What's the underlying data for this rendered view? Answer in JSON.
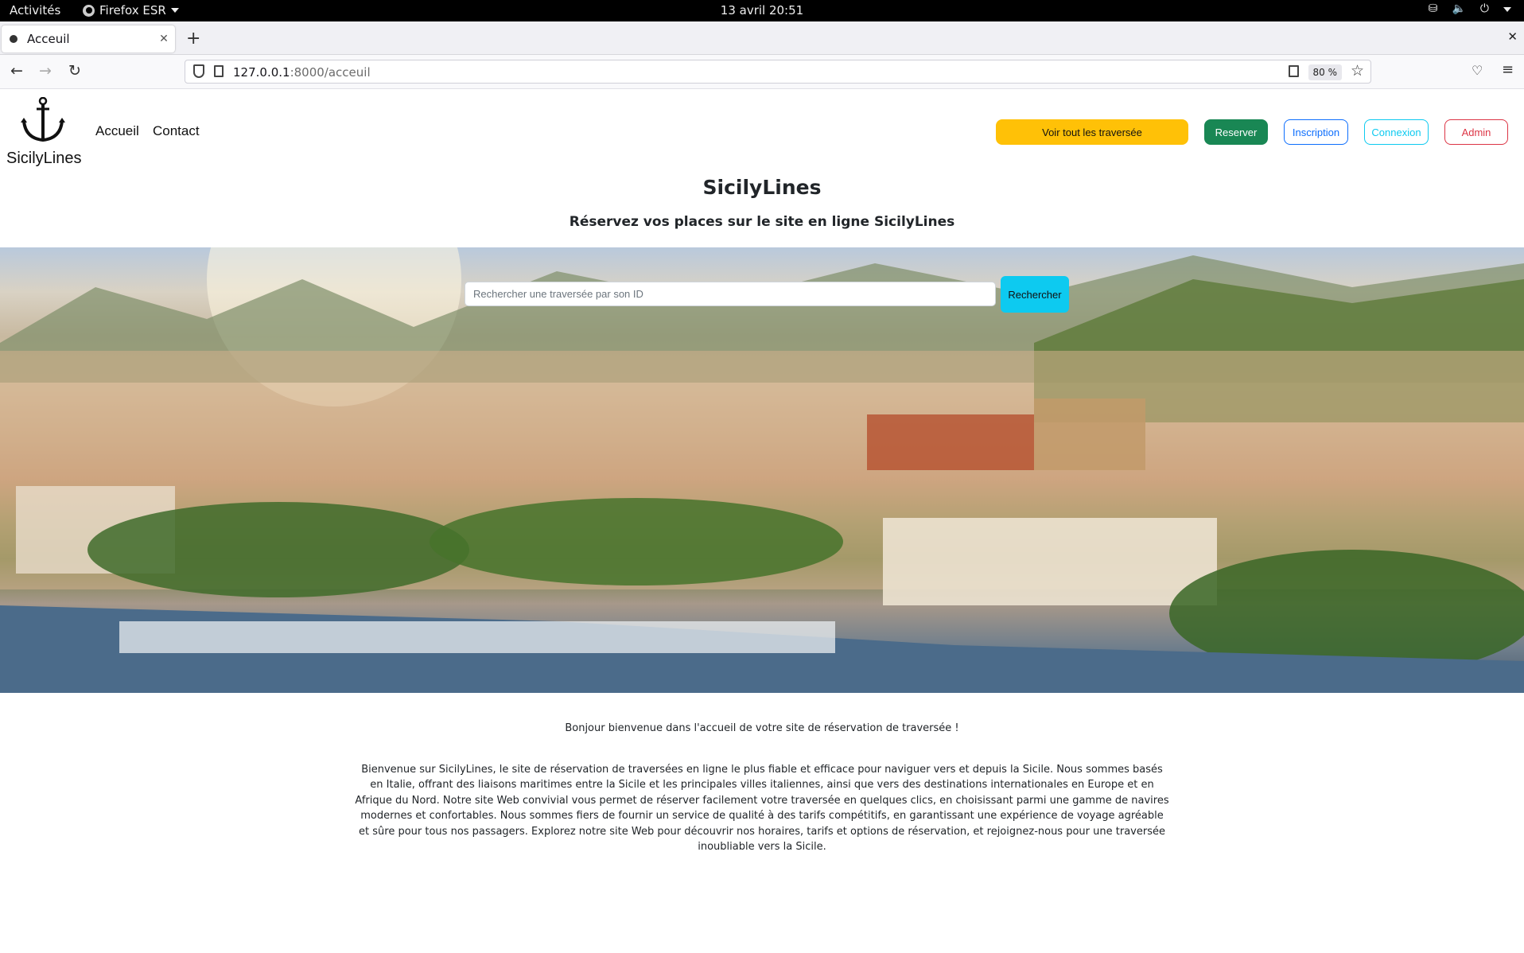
{
  "system_bar": {
    "activities": "Activités",
    "app_name": "Firefox ESR",
    "clock": "13 avril  20:51"
  },
  "browser": {
    "tab_title": "Acceuil",
    "url_host": "127.0.0.1",
    "url_path": ":8000/acceuil",
    "zoom": "80 %"
  },
  "site": {
    "logo_text": "SicilyLines",
    "nav": [
      "Accueil",
      "Contact"
    ],
    "buttons": {
      "all_crossings": "Voir tout les traversée",
      "reserve": "Reserver",
      "signup": "Inscription",
      "login": "Connexion",
      "admin": "Admin"
    },
    "title": "SicilyLines",
    "subtitle": "Réservez vos places sur le site en ligne SicilyLines",
    "search": {
      "placeholder": "Rechercher une traversée par son ID",
      "button": "Rechercher"
    },
    "welcome": "Bonjour bienvenue dans l'accueil de votre site de réservation de traversée !",
    "description": "Bienvenue sur SicilyLines, le site de réservation de traversées en ligne le plus fiable et efficace pour naviguer vers et depuis la Sicile. Nous sommes basés en Italie, offrant des liaisons maritimes entre la Sicile et les principales villes italiennes, ainsi que vers des destinations internationales en Europe et en Afrique du Nord. Notre site Web convivial vous permet de réserver facilement votre traversée en quelques clics, en choisissant parmi une gamme de navires modernes et confortables. Nous sommes fiers de fournir un service de qualité à des tarifs compétitifs, en garantissant une expérience de voyage agréable et sûre pour tous nos passagers. Explorez notre site Web pour découvrir nos horaires, tarifs et options de réservation, et rejoignez-nous pour une traversée inoubliable vers la Sicile."
  },
  "colors": {
    "warning": "#ffc107",
    "success": "#198754",
    "primary": "#0d6efd",
    "info": "#0dcaf0",
    "danger": "#dc3545"
  }
}
